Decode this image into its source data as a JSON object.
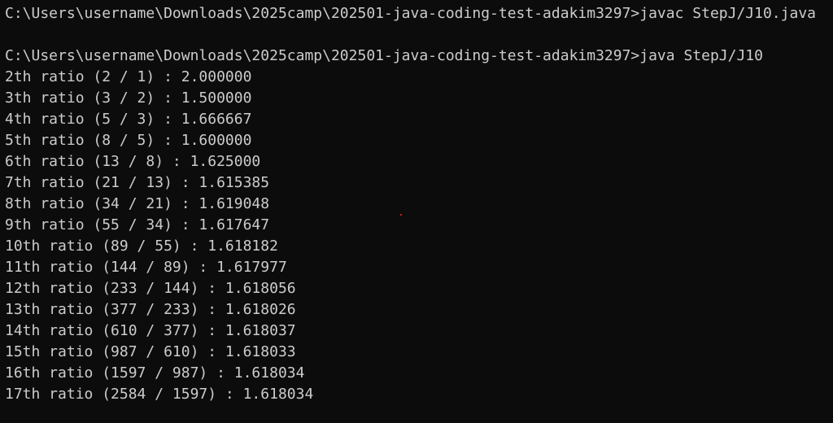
{
  "terminal": {
    "compile_command": "C:\\Users\\username\\Downloads\\2025camp\\202501-java-coding-test-adakim3297>javac StepJ/J10.java",
    "run_command": "C:\\Users\\username\\Downloads\\2025camp\\202501-java-coding-test-adakim3297>java StepJ/J10",
    "output": [
      "2th ratio (2 / 1) : 2.000000",
      "3th ratio (3 / 2) : 1.500000",
      "4th ratio (5 / 3) : 1.666667",
      "5th ratio (8 / 5) : 1.600000",
      "6th ratio (13 / 8) : 1.625000",
      "7th ratio (21 / 13) : 1.615385",
      "8th ratio (34 / 21) : 1.619048",
      "9th ratio (55 / 34) : 1.617647",
      "10th ratio (89 / 55) : 1.618182",
      "11th ratio (144 / 89) : 1.617977",
      "12th ratio (233 / 144) : 1.618056",
      "13th ratio (377 / 233) : 1.618026",
      "14th ratio (610 / 377) : 1.618037",
      "15th ratio (987 / 610) : 1.618033",
      "16th ratio (1597 / 987) : 1.618034",
      "17th ratio (2584 / 1597) : 1.618034"
    ],
    "colors": {
      "background": "#0c0c0c",
      "text": "#cccccc",
      "stray_dot": "#d11a1a"
    }
  }
}
